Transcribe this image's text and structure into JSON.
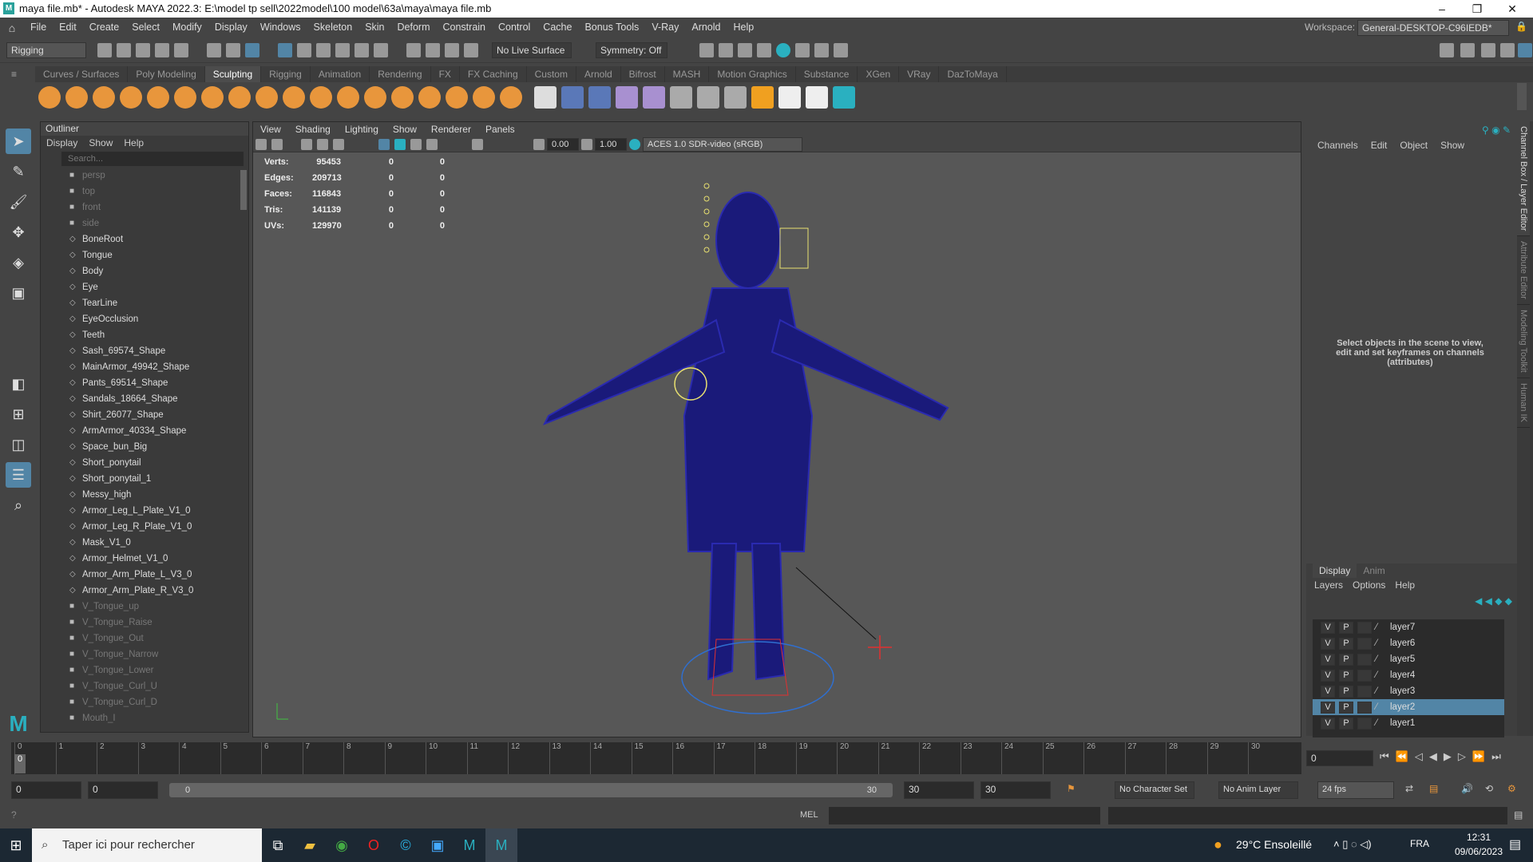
{
  "title": "maya file.mb* - Autodesk MAYA 2022.3: E:\\model tp sell\\2022model\\100 model\\63a\\maya\\maya file.mb",
  "menus": [
    "File",
    "Edit",
    "Create",
    "Select",
    "Modify",
    "Display",
    "Windows",
    "Skeleton",
    "Skin",
    "Deform",
    "Constrain",
    "Control",
    "Cache",
    "Bonus Tools",
    "V-Ray",
    "Arnold",
    "Help"
  ],
  "workspace_label": "Workspace:",
  "workspace_value": "General-DESKTOP-C96IEDB*",
  "menuset": "Rigging",
  "live_surface": "No Live Surface",
  "symmetry": "Symmetry: Off",
  "shelf_tabs": [
    "Curves / Surfaces",
    "Poly Modeling",
    "Sculpting",
    "Rigging",
    "Animation",
    "Rendering",
    "FX",
    "FX Caching",
    "Custom",
    "Arnold",
    "Bifrost",
    "MASH",
    "Motion Graphics",
    "Substance",
    "XGen",
    "VRay",
    "DazToMaya"
  ],
  "shelf_active": "Sculpting",
  "outliner": {
    "title": "Outliner",
    "menu": [
      "Display",
      "Show",
      "Help"
    ],
    "search_placeholder": "Search...",
    "items": [
      {
        "n": "persp",
        "d": true
      },
      {
        "n": "top",
        "d": true
      },
      {
        "n": "front",
        "d": true
      },
      {
        "n": "side",
        "d": true
      },
      {
        "n": "BoneRoot"
      },
      {
        "n": "Tongue"
      },
      {
        "n": "Body"
      },
      {
        "n": "Eye"
      },
      {
        "n": "TearLine"
      },
      {
        "n": "EyeOcclusion"
      },
      {
        "n": "Teeth"
      },
      {
        "n": "Sash_69574_Shape"
      },
      {
        "n": "MainArmor_49942_Shape"
      },
      {
        "n": "Pants_69514_Shape"
      },
      {
        "n": "Sandals_18664_Shape"
      },
      {
        "n": "Shirt_26077_Shape"
      },
      {
        "n": "ArmArmor_40334_Shape"
      },
      {
        "n": "Space_bun_Big"
      },
      {
        "n": "Short_ponytail"
      },
      {
        "n": "Short_ponytail_1"
      },
      {
        "n": "Messy_high"
      },
      {
        "n": "Armor_Leg_L_Plate_V1_0"
      },
      {
        "n": "Armor_Leg_R_Plate_V1_0"
      },
      {
        "n": "Mask_V1_0"
      },
      {
        "n": "Armor_Helmet_V1_0"
      },
      {
        "n": "Armor_Arm_Plate_L_V3_0"
      },
      {
        "n": "Armor_Arm_Plate_R_V3_0"
      },
      {
        "n": "V_Tongue_up",
        "d": true
      },
      {
        "n": "V_Tongue_Raise",
        "d": true
      },
      {
        "n": "V_Tongue_Out",
        "d": true
      },
      {
        "n": "V_Tongue_Narrow",
        "d": true
      },
      {
        "n": "V_Tongue_Lower",
        "d": true
      },
      {
        "n": "V_Tongue_Curl_U",
        "d": true
      },
      {
        "n": "V_Tongue_Curl_D",
        "d": true
      },
      {
        "n": "Mouth_I",
        "d": true
      }
    ]
  },
  "viewport": {
    "menu": [
      "View",
      "Shading",
      "Lighting",
      "Show",
      "Renderer",
      "Panels"
    ],
    "exposure": "0.00",
    "gamma": "1.00",
    "colorspace": "ACES 1.0 SDR-video (sRGB)",
    "stats": [
      {
        "label": "Verts:",
        "v": "95453",
        "a": "0",
        "b": "0"
      },
      {
        "label": "Edges:",
        "v": "209713",
        "a": "0",
        "b": "0"
      },
      {
        "label": "Faces:",
        "v": "116843",
        "a": "0",
        "b": "0"
      },
      {
        "label": "Tris:",
        "v": "141139",
        "a": "0",
        "b": "0"
      },
      {
        "label": "UVs:",
        "v": "129970",
        "a": "0",
        "b": "0"
      }
    ]
  },
  "channelbox": {
    "menu": [
      "Channels",
      "Edit",
      "Object",
      "Show"
    ],
    "hint": "Select objects in the scene to view, edit and set keyframes on channels (attributes)"
  },
  "side_tabs": [
    "Channel Box / Layer Editor",
    "Attribute Editor",
    "Modeling Toolkit",
    "Human IK"
  ],
  "layer_editor": {
    "tabs": [
      "Display",
      "Anim"
    ],
    "menu": [
      "Layers",
      "Options",
      "Help"
    ],
    "v": "V",
    "p": "P",
    "layers": [
      {
        "name": "layer7"
      },
      {
        "name": "layer6"
      },
      {
        "name": "layer5"
      },
      {
        "name": "layer4"
      },
      {
        "name": "layer3"
      },
      {
        "name": "layer2",
        "selected": true
      },
      {
        "name": "layer1"
      }
    ]
  },
  "timeline": {
    "ticks": [
      "0",
      "1",
      "2",
      "3",
      "4",
      "5",
      "6",
      "7",
      "8",
      "9",
      "10",
      "11",
      "12",
      "13",
      "14",
      "15",
      "16",
      "17",
      "18",
      "19",
      "20",
      "21",
      "22",
      "23",
      "24",
      "25",
      "26",
      "27",
      "28",
      "29",
      "30"
    ],
    "current": "0",
    "current_field": "0"
  },
  "range": {
    "start": "0",
    "anim_start": "0",
    "slider_start": "0",
    "slider_end": "30",
    "end": "30",
    "anim_end": "30",
    "character_set": "No Character Set",
    "anim_layer": "No Anim Layer",
    "fps": "24 fps"
  },
  "cmdline": {
    "lang": "MEL"
  },
  "taskbar": {
    "search": "Taper ici pour rechercher",
    "weather": "29°C  Ensoleillé",
    "lang": "FRA",
    "time": "12:31",
    "date": "09/06/2023"
  }
}
